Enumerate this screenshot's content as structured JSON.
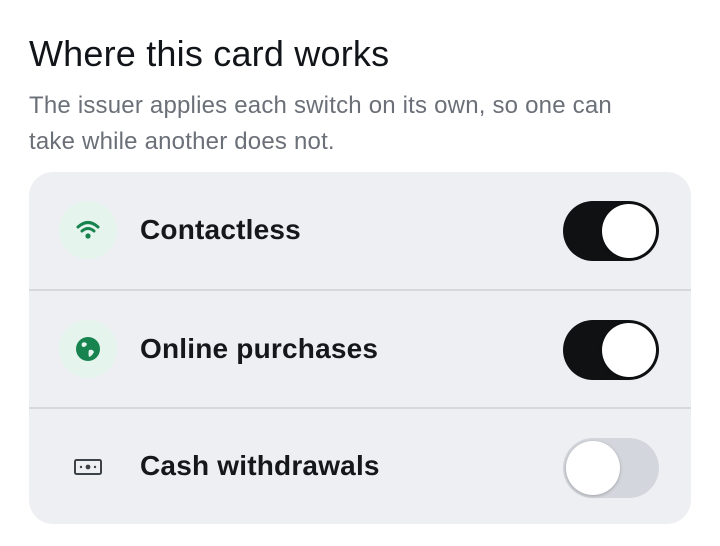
{
  "header": {
    "title": "Where this card works",
    "subtitle_line1": "The issuer applies each switch on its own, so one can",
    "subtitle_line2": "take while another does not."
  },
  "settings": [
    {
      "label": "Contactless",
      "icon": "wifi-icon",
      "enabled": true
    },
    {
      "label": "Online purchases",
      "icon": "globe-icon",
      "enabled": true
    },
    {
      "label": "Cash withdrawals",
      "icon": "cash-icon",
      "enabled": false
    }
  ],
  "colors": {
    "accent_green": "#17844f",
    "toggle_on": "#0f1113",
    "toggle_off": "#d3d6dc"
  }
}
